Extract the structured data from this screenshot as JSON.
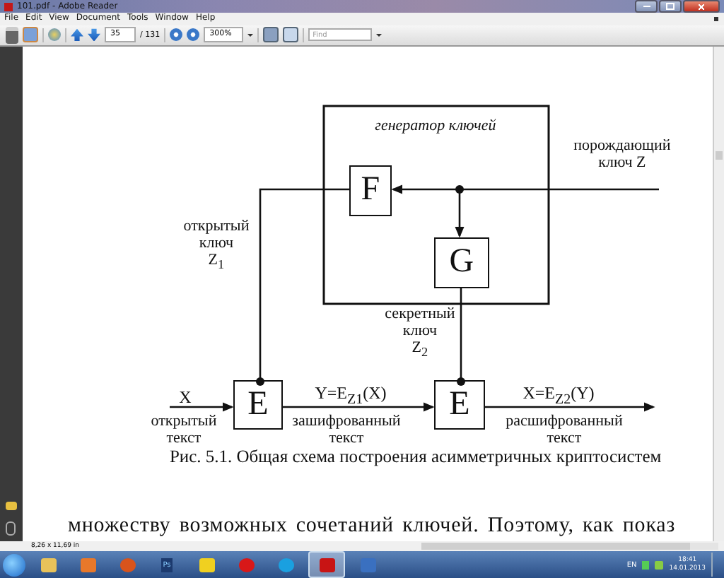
{
  "window": {
    "title": "101.pdf - Adobe Reader"
  },
  "menu": [
    "File",
    "Edit",
    "View",
    "Document",
    "Tools",
    "Window",
    "Help"
  ],
  "toolbar": {
    "page": "35",
    "page_count": "/ 131",
    "zoom": "300%",
    "find": {
      "placeholder": "Find"
    }
  },
  "diagram": {
    "blocks": [
      {
        "label": "F"
      },
      {
        "label": "G"
      },
      {
        "label": "E"
      },
      {
        "label": "E"
      }
    ],
    "labels": [
      {
        "text": "генератор ключей",
        "italic": true
      },
      {
        "text": "порождающий\nключ Z",
        "italic": false
      },
      {
        "text": "открытый\nключ\nZ$_{1}$",
        "italic": false
      },
      {
        "text": "секретный\nключ\nZ$_{2}$",
        "italic": false
      },
      {
        "text": "X",
        "italic": false
      },
      {
        "text": "открытый\nтекст",
        "italic": false
      },
      {
        "text": "Y=E$_{Z1}$(X)",
        "italic": false
      },
      {
        "text": "зашифрованный\nтекст",
        "italic": false
      },
      {
        "text": "X=E$_{Z2}$(Y)",
        "italic": false
      },
      {
        "text": "расшифрованный\nтекст",
        "italic": false
      }
    ]
  },
  "caption": "Рис. 5.1. Общая схема построения асимметричных криптосистем",
  "body_text": "множеству возможных сочетаний ключей. Поэтому, как показ",
  "status_bar": {
    "page_size": "8,26 x 11,69 in"
  },
  "taskbar": {
    "apps": [
      {
        "kind": "folder",
        "active": false
      },
      {
        "kind": "player",
        "active": false
      },
      {
        "kind": "orange",
        "active": false
      },
      {
        "kind": "ps",
        "label": "Ps",
        "active": false
      },
      {
        "kind": "bat",
        "active": false
      },
      {
        "kind": "ring",
        "active": false
      },
      {
        "kind": "chat",
        "active": false
      },
      {
        "kind": "pdf",
        "active": true
      },
      {
        "kind": "window",
        "active": false
      }
    ],
    "language": "EN",
    "time": "18:41",
    "date": "14.01.2013"
  }
}
